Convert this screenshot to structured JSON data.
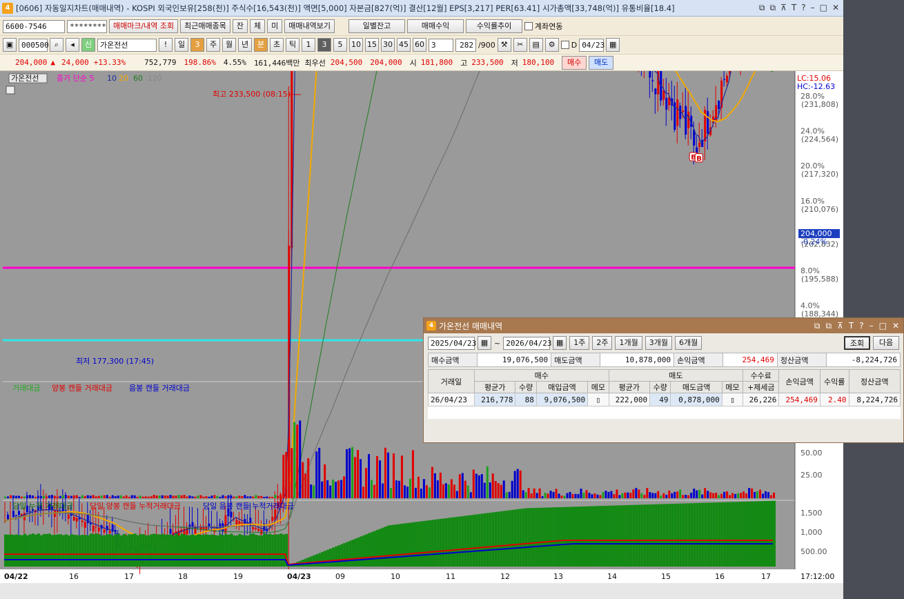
{
  "app": {
    "title": "[0606] 자동일지차트(매매내역) - KOSPI 외국인보유[258(천)] 주식수[16,543(천)] 액면[5,000] 자본금[827(억)] 결산[12월] EPS[3,217] PER[63.41] 시가총액[33,748(억)] 유통비율[18.4]",
    "window_buttons": [
      "⧉",
      "⧉",
      "⊼",
      "T",
      "?",
      "–",
      "□",
      "✕"
    ]
  },
  "toolbar1": {
    "account": "6600-7546",
    "password": "********",
    "btn_mark": "매매마크/내역 조회",
    "btn_recent": "최근매매종목",
    "btn_jan": "잔",
    "btn_che": "체",
    "btn_mi": "미",
    "btn_history": "매매내역보기",
    "btn_daily_balance": "일별잔고",
    "btn_profit": "매매수익",
    "btn_return_trend": "수익률추이",
    "account_link_label": "계좌연동"
  },
  "toolbar2": {
    "code": "000500",
    "badge_sin": "신",
    "stock_name": "가온전선",
    "excl": "!",
    "period_day": "일",
    "period_num": "3",
    "periods": [
      "주",
      "월",
      "년",
      "분",
      "초",
      "틱"
    ],
    "intervals": [
      "1",
      "3",
      "5",
      "10",
      "15",
      "30",
      "45",
      "60"
    ],
    "active_interval": "3",
    "interval_select": "3",
    "count": "282",
    "count_total": "/900",
    "d_label": "D",
    "date": "04/23"
  },
  "quote": {
    "price": "204,000",
    "arrow": "▲",
    "change": "24,000",
    "change_pct": "+13.33%",
    "volume": "752,779",
    "vol_ratio": "198.86%",
    "turnover": "4.55%",
    "amount": "161,446백만",
    "best_label": "최우선",
    "ask": "204,500",
    "bid": "204,000",
    "open_label": "시",
    "open": "181,800",
    "high_label": "고",
    "high": "233,500",
    "low_label": "저",
    "low": "180,100",
    "buy_btn": "매수",
    "sell_btn": "매도"
  },
  "chart": {
    "legend_name": "가온전선",
    "legend_ma": "종가 단순 5",
    "ma_periods": [
      "10",
      "20",
      "60",
      "120"
    ],
    "high_annot": "최고 233,500 (08:15)",
    "low_annot": "최저 177,300 (17:45)",
    "lc": "LC:15.06",
    "hc": "HC:-12.63",
    "price_axis": [
      {
        "pct": "28.0%",
        "val": "(231,808)"
      },
      {
        "pct": "24.0%",
        "val": "(224,564)"
      },
      {
        "pct": "20.0%",
        "val": "(217,320)"
      },
      {
        "pct": "16.0%",
        "val": "(210,076)"
      },
      {
        "pct": "12.0%",
        "val": "(202,832)"
      },
      {
        "pct": "8.0%",
        "val": "(195,588)"
      },
      {
        "pct": "4.0%",
        "val": "(188,344)"
      }
    ],
    "current_price_tag": "204,000",
    "current_pct_tag": "-0.24%",
    "vol_legend": [
      "거래대금",
      "양봉 캔들 거래대금",
      "음봉 캔들 거래대금"
    ],
    "vol_axis": [
      "50.00",
      "25.00"
    ],
    "cum_legend": [
      "당일 누적 거래대금",
      "당일 양봉 캔들 누적거래대금",
      "당일 음봉 캔들 누적거래대금"
    ],
    "cum_axis": [
      "1,500",
      "1,000",
      "500.00"
    ],
    "x_labels": [
      "04/22",
      "16",
      "17",
      "18",
      "19",
      "04/23",
      "09",
      "10",
      "11",
      "12",
      "13",
      "14",
      "15",
      "16",
      "17"
    ],
    "time": "17:12:00",
    "colors": {
      "bg": "#9a9a9a",
      "up": "#e00000",
      "down": "#0000cc",
      "ma5": "#1b2a9a",
      "ma20": "#f2a900",
      "ma60": "#1e7d1e",
      "ma120": "#6b6b6b",
      "magenta": "#ff00cc",
      "cyan": "#2ee6e6"
    }
  },
  "markers": [
    {
      "t": "B",
      "i": 147
    },
    {
      "t": "B",
      "i": 149
    },
    {
      "t": "B",
      "i": 150
    },
    {
      "t": "S",
      "i": 148
    },
    {
      "t": "S",
      "i": 180
    },
    {
      "t": "S",
      "i": 181
    },
    {
      "t": "B",
      "i": 168
    },
    {
      "t": "B",
      "i": 172
    },
    {
      "t": "B",
      "i": 186
    },
    {
      "t": "B",
      "i": 189
    },
    {
      "t": "B",
      "i": 250
    },
    {
      "t": "B",
      "i": 252
    }
  ],
  "popup": {
    "title": "가온전선 매매내역",
    "date_from": "2025/04/23",
    "tilde": "~",
    "date_to": "2026/04/23",
    "range_buttons": [
      "1주",
      "2주",
      "1개월",
      "3개월",
      "6개월"
    ],
    "btn_query": "조회",
    "btn_next": "다음",
    "summary": {
      "buy_amount_label": "매수금액",
      "buy_amount": "19,076,500",
      "sell_amount_label": "매도금액",
      "sell_amount": "10,878,000",
      "pl_label": "손익금액",
      "pl": "254,469",
      "settle_label": "정산금액",
      "settle": "-8,224,726"
    },
    "headers": {
      "date": "거래일",
      "buy": "매수",
      "sell": "매도",
      "fee": "수수료",
      "fee2": "+제세금",
      "pl": "손익금액",
      "ret": "수익률",
      "settle": "정산금액",
      "avg": "평균가",
      "qty": "수량",
      "buy_amt": "매입금액",
      "memo": "메모",
      "sell_amt": "매도금액"
    },
    "rows": [
      {
        "date": "26/04/23",
        "buy_avg": "216,778",
        "buy_qty": "88",
        "buy_amt": "9,076,500",
        "sell_avg": "222,000",
        "sell_qty": "49",
        "sell_amt": "0,878,000",
        "fee": "26,226",
        "pl": "254,469",
        "ret": "2.40",
        "settle": "8,224,726"
      }
    ]
  }
}
